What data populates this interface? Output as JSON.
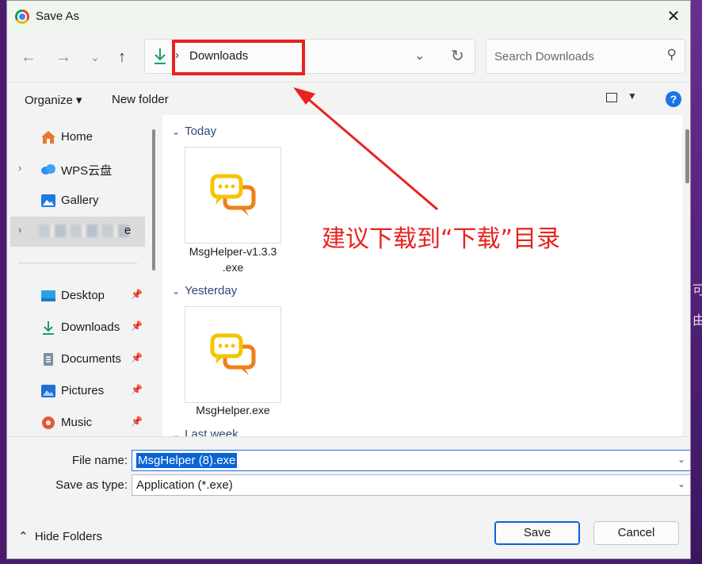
{
  "window": {
    "title": "Save As"
  },
  "nav": {
    "back_icon": "back-arrow-icon",
    "forward_icon": "forward-arrow-icon",
    "recent_icon": "chevron-down-icon",
    "up_icon": "up-arrow-icon",
    "address": {
      "separator": "›",
      "location": "Downloads"
    },
    "search_placeholder": "Search Downloads"
  },
  "toolbar": {
    "organize": "Organize ▾",
    "new_folder": "New folder",
    "help": "?"
  },
  "sidebar": {
    "items": [
      {
        "label": "Home",
        "icon": "home-icon",
        "caret": "",
        "pinned": false
      },
      {
        "label": "WPS云盘",
        "icon": "cloud-icon",
        "caret": "›",
        "pinned": false
      },
      {
        "label": "Gallery",
        "icon": "gallery-icon",
        "caret": "",
        "pinned": false
      },
      {
        "label": "e",
        "icon": "onedrive-icon",
        "caret": "›",
        "pinned": false,
        "selected": true,
        "blurred": true
      },
      {
        "label": "Desktop",
        "icon": "desktop-icon",
        "caret": "",
        "pinned": true
      },
      {
        "label": "Downloads",
        "icon": "download-icon",
        "caret": "",
        "pinned": true
      },
      {
        "label": "Documents",
        "icon": "documents-icon",
        "caret": "",
        "pinned": true
      },
      {
        "label": "Pictures",
        "icon": "pictures-icon",
        "caret": "",
        "pinned": true
      },
      {
        "label": "Music",
        "icon": "music-icon",
        "caret": "",
        "pinned": true
      }
    ]
  },
  "content": {
    "groups": [
      {
        "header": "Today",
        "files": [
          {
            "name": "MsgHelper-v1.3.3.exe",
            "line1": "MsgHelper-v1.3.3",
            "line2": ".exe"
          }
        ]
      },
      {
        "header": "Yesterday",
        "files": [
          {
            "name": "MsgHelper.exe",
            "line1": "MsgHelper.exe",
            "line2": ""
          }
        ]
      },
      {
        "header": "Last week",
        "files": []
      }
    ]
  },
  "annotation": {
    "text": "建议下载到“下载”目录",
    "color": "#e8231f"
  },
  "form": {
    "file_name_label": "File name:",
    "file_name_value": "MsgHelper (8).exe",
    "save_type_label": "Save as type:",
    "save_type_value": "Application (*.exe)"
  },
  "footer": {
    "hide_folders": "Hide Folders",
    "save": "Save",
    "cancel": "Cancel"
  },
  "colors": {
    "accent": "#0a64d6",
    "highlight": "#e8231f",
    "app_icon_yellow": "#f5c400",
    "app_icon_orange": "#f07f1a"
  }
}
